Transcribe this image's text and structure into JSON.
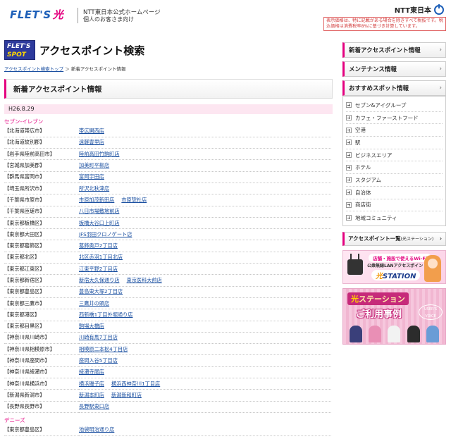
{
  "header": {
    "brand": "FLET'S",
    "brand_hikari": "光",
    "sub1": "NTT東日本公式ホームページ",
    "sub2": "個人のお客さま向け",
    "ntt": "NTT東日本",
    "tax_note": "表示価格は、特に記載がある場合を除きすべて税抜です。税込価格は消費税率8%に基づき計算しています。"
  },
  "brand_row": {
    "logo_l1": "FLET'S",
    "logo_l2": "SPOT",
    "title": "アクセスポイント検索"
  },
  "breadcrumb": {
    "home": "アクセスポイント検索トップ",
    "separator": "＞",
    "current": "新着アクセスポイント情報"
  },
  "section_title": "新着アクセスポイント情報",
  "date": "H26.8.29",
  "categories": [
    {
      "name": "セブン-イレブン",
      "rows": [
        {
          "pref": "【北海道帯広市】",
          "shops": [
            "帯広開西店"
          ]
        },
        {
          "pref": "【北海道紋別郡】",
          "shops": [
            "遠軽豊里店"
          ]
        },
        {
          "pref": "【岩手県陸前高田市】",
          "shops": [
            "陸前高田竹駒町店"
          ]
        },
        {
          "pref": "【宮城県加美郡】",
          "shops": [
            "加美町平柳店"
          ]
        },
        {
          "pref": "【群馬県富岡市】",
          "shops": [
            "富岡宇田店"
          ]
        },
        {
          "pref": "【埼玉県所沢市】",
          "shops": [
            "所沢北秋津店"
          ]
        },
        {
          "pref": "【千葉県市原市】",
          "shops": [
            "市原加茂新田店",
            "市原惣社店"
          ]
        },
        {
          "pref": "【千葉県匝瑳市】",
          "shops": [
            "八日市場敷地前店"
          ]
        },
        {
          "pref": "【東京都板橋区】",
          "shops": [
            "板橋大谷口上町店"
          ]
        },
        {
          "pref": "【東京都大田区】",
          "shops": [
            "JFS羽田クロノゲート店"
          ]
        },
        {
          "pref": "【東京都葛飾区】",
          "shops": [
            "葛飾奥戸2丁目店"
          ]
        },
        {
          "pref": "【東京都北区】",
          "shops": [
            "北区赤羽1丁目北店"
          ]
        },
        {
          "pref": "【東京都江東区】",
          "shops": [
            "江東平野2丁目店"
          ]
        },
        {
          "pref": "【東京都新宿区】",
          "shops": [
            "新宿大久保通り店",
            "東京医科大前店"
          ]
        },
        {
          "pref": "【東京都豊島区】",
          "shops": [
            "豊島東大塚2丁目店"
          ]
        },
        {
          "pref": "【東京都三鷹市】",
          "shops": [
            "三鷹井の頭店"
          ]
        },
        {
          "pref": "【東京都港区】",
          "shops": [
            "西新橋1丁目外堀通り店"
          ]
        },
        {
          "pref": "【東京都目黒区】",
          "shops": [
            "駒場大橋店"
          ]
        },
        {
          "pref": "【神奈川県川崎市】",
          "shops": [
            "川崎有馬7丁目店"
          ]
        },
        {
          "pref": "【神奈川県相模原市】",
          "shops": [
            "相模原二本松4丁目店"
          ]
        },
        {
          "pref": "【神奈川県座間市】",
          "shops": [
            "座間入谷5丁目店"
          ]
        },
        {
          "pref": "【神奈川県綾瀬市】",
          "shops": [
            "綾瀬寺尾店"
          ]
        },
        {
          "pref": "【神奈川県横浜市】",
          "shops": [
            "横浜磯子店",
            "横浜西神奈川1丁目店"
          ]
        },
        {
          "pref": "【新潟県新潟市】",
          "shops": [
            "新潟本町店",
            "新潟新和町店"
          ]
        },
        {
          "pref": "【長野県長野市】",
          "shops": [
            "長野駅東口店"
          ]
        }
      ]
    },
    {
      "name": "デニーズ",
      "rows": [
        {
          "pref": "【東京都豊島区】",
          "shops": [
            "池袋明治通り店"
          ]
        }
      ]
    }
  ],
  "sidebar": {
    "new_info": "新着アクセスポイント情報",
    "maintenance": "メンテナンス情報",
    "recommended": "おすすめスポット情報",
    "spots": [
      "セブン&アイグループ",
      "カフェ・ファーストフード",
      "空港",
      "駅",
      "ビジネスエリア",
      "ホテル",
      "スタジアム",
      "自治体",
      "商店街",
      "地域コミュニティ"
    ],
    "ap_list": "アクセスポイント一覧",
    "ap_list_note": "(光ステーション)",
    "chevron": "›"
  },
  "banner1": {
    "top": "店舗・施設で使えるWi-Fi",
    "mid": "公衆無線LANアクセスポイント",
    "station_hikari": "光",
    "station": "STATION"
  },
  "banner2": {
    "title_hikari": "光",
    "title": "ステーション",
    "sub": "ご利用事例",
    "voice": "USER'S VOICE"
  },
  "colors": {
    "accent": "#e4007f",
    "link": "#1a4fa0",
    "brand_blue": "#1d5fb8"
  }
}
